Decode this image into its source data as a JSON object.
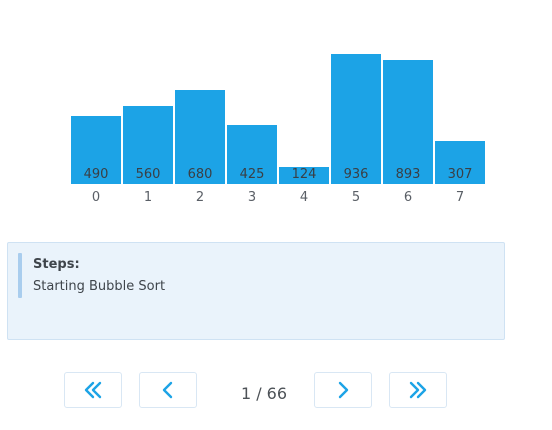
{
  "visualizer": {
    "bars": [
      {
        "index": "0",
        "value": 490
      },
      {
        "index": "1",
        "value": 560
      },
      {
        "index": "2",
        "value": 680
      },
      {
        "index": "3",
        "value": 425
      },
      {
        "index": "4",
        "value": 124
      },
      {
        "index": "5",
        "value": 936
      },
      {
        "index": "6",
        "value": 893
      },
      {
        "index": "7",
        "value": 307
      }
    ],
    "bar_color": "#1ca3e6"
  },
  "steps": {
    "title": "Steps:",
    "text": "Starting Bubble Sort"
  },
  "pagination": {
    "current": 1,
    "total": 66,
    "label": "1 / 66",
    "first_icon": "double-chevron-left-icon",
    "prev_icon": "chevron-left-icon",
    "next_icon": "chevron-right-icon",
    "last_icon": "double-chevron-right-icon",
    "icon_color": "#1ca3e6"
  }
}
